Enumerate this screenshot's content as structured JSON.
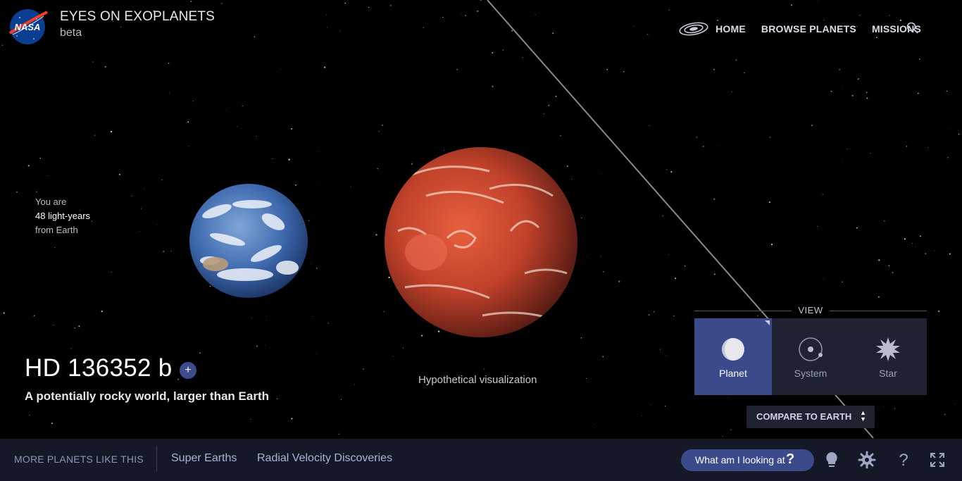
{
  "header": {
    "logo_text": "NASA",
    "title": "EYES ON EXOPLANETS",
    "subtitle": "beta",
    "nav": [
      {
        "label": "HOME",
        "icon": "galaxy-icon"
      },
      {
        "label": "BROWSE PLANETS"
      },
      {
        "label": "MISSIONS"
      }
    ],
    "search_icon": "search-icon"
  },
  "distance": {
    "line1": "You are",
    "line2": "48 light-years",
    "line3": "from Earth"
  },
  "planet": {
    "name": "HD 136352 b",
    "plus_label": "+",
    "description": "A potentially rocky world, larger than Earth",
    "caption": "Hypothetical visualization"
  },
  "view": {
    "label": "VIEW",
    "options": [
      {
        "label": "Planet",
        "icon": "planet-icon",
        "active": true
      },
      {
        "label": "System",
        "icon": "system-icon",
        "active": false
      },
      {
        "label": "Star",
        "icon": "star-icon",
        "active": false
      }
    ],
    "compare_label": "COMPARE TO EARTH"
  },
  "bottom": {
    "more_label": "MORE PLANETS LIKE THIS",
    "links": [
      "Super Earths",
      "Radial Velocity Discoveries"
    ],
    "what_label": "What am I looking at",
    "what_icon": "?",
    "icons": [
      "lightbulb-icon",
      "settings-gear-icon",
      "help-icon",
      "fullscreen-icon"
    ],
    "help_glyph": "?"
  },
  "colors": {
    "accent": "#3a4a8a",
    "bar": "#141827",
    "panel": "#1f2230"
  }
}
